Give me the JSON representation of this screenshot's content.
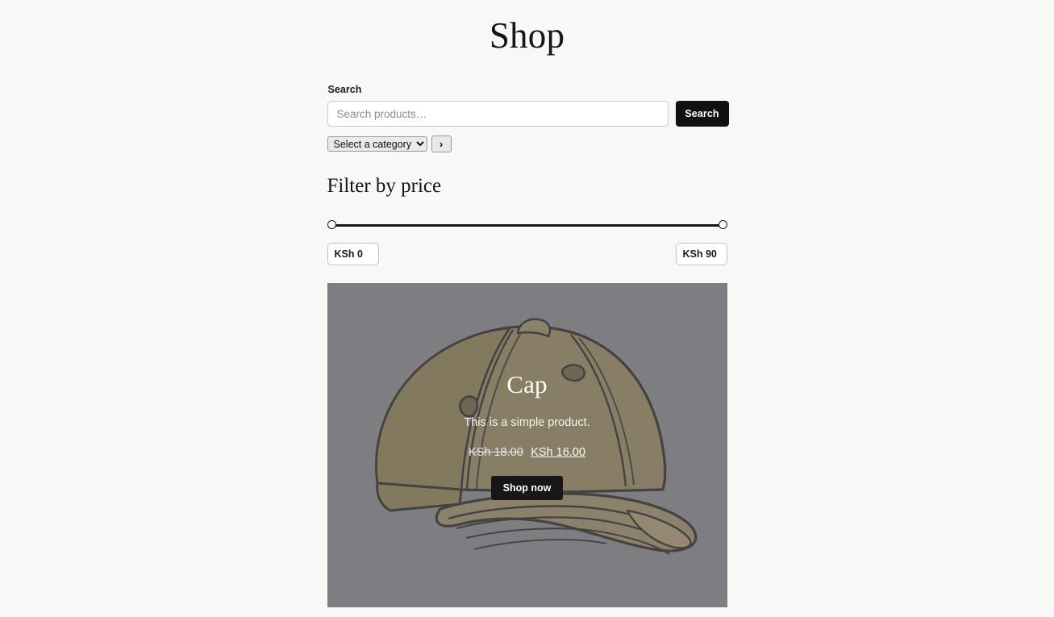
{
  "page": {
    "title": "Shop",
    "background_color": "#f8f8f7"
  },
  "search": {
    "label": "Search",
    "placeholder": "Search products…",
    "value": "",
    "submit_label": "Search",
    "submit_color": "#111113"
  },
  "category": {
    "selected": "Select a category",
    "options": [
      "Select a category"
    ],
    "go_icon": "chevron-right-icon",
    "go_glyph": "›"
  },
  "price_filter": {
    "title": "Filter by price",
    "min_value": "KSh 0",
    "max_value": "KSh 90",
    "currency": "KSh",
    "range_min": 0,
    "range_max": 90,
    "handle_left_percent": 0,
    "handle_right_percent": 100,
    "track_color": "#17171a"
  },
  "product": {
    "name": "Cap",
    "description": "This is a simple product.",
    "price_regular": "KSh 18.00",
    "price_sale": "KSh 16.00",
    "cta_label": "Shop now",
    "image_alt": "Cap",
    "overlay_color": "#77777b",
    "art_fill": "#9c8855",
    "art_fill_dark": "#8a7748",
    "art_fill_light": "#b19a66",
    "art_line": "#1b1710"
  }
}
